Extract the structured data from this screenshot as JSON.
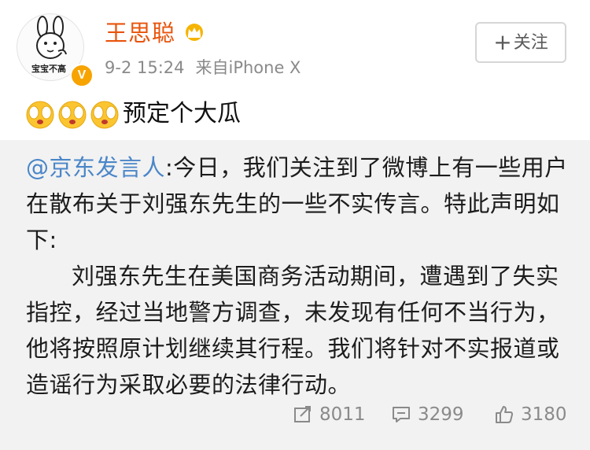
{
  "header": {
    "avatar_caption": "宝宝不高",
    "verified_badge": "V",
    "username": "王思聪",
    "crown": "crown-icon",
    "time": "9-2 15:24",
    "source": "来自iPhone X",
    "follow_plus": "+",
    "follow_label": "关注"
  },
  "post": {
    "emojis": [
      "covering-face-emoji",
      "covering-face-emoji",
      "covering-face-emoji"
    ],
    "text": "预定个大瓜"
  },
  "repost": {
    "mention": "@京东发言人",
    "paragraph1": ":今日，我们关注到了微博上有一些用户在散布关于刘强东先生的一些不实传言。特此声明如下:",
    "paragraph2": "刘强东先生在美国商务活动期间，遭遇到了失实指控，经过当地警方调查，未发现有任何不当行为，他将按照原计划继续其行程。我们将针对不实报道或造谣行为采取必要的法律行动。",
    "stats": {
      "reposts": "8011",
      "comments": "3299",
      "likes": "3180"
    }
  },
  "colors": {
    "username": "#e8540c",
    "mention": "#4a86c8",
    "meta": "#8a8a8a",
    "repost_bg": "#f2f2f2",
    "badge": "#f7a300"
  }
}
